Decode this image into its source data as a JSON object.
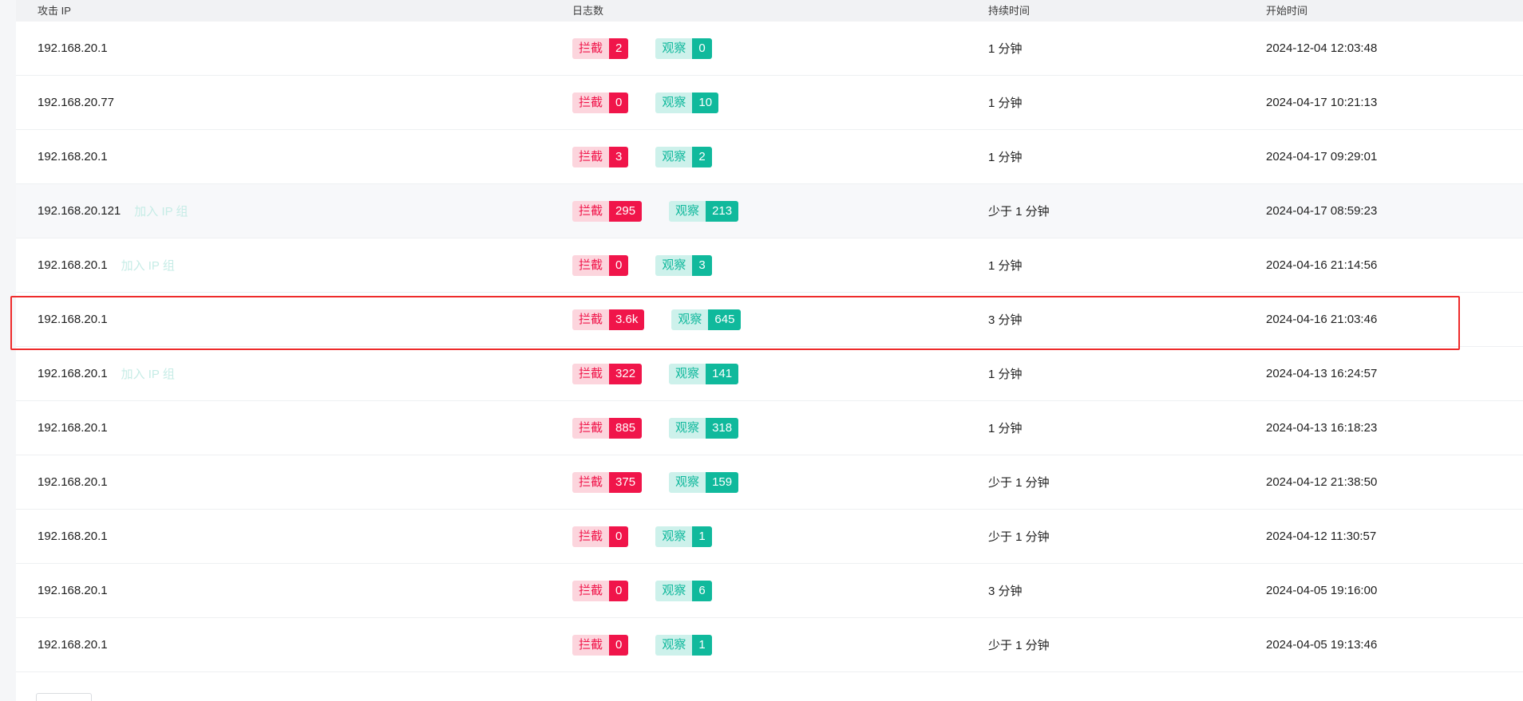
{
  "table": {
    "columns": {
      "ip": "攻击 IP",
      "logs": "日志数",
      "duration": "持续时间",
      "start_time": "开始时间"
    },
    "block_label": "拦截",
    "watch_label": "观察",
    "add_group_label": "加入 IP 组",
    "rows": [
      {
        "ip": "192.168.20.1",
        "block": "2",
        "watch": "0",
        "duration": "1 分钟",
        "start": "2024-12-04 12:03:48"
      },
      {
        "ip": "192.168.20.77",
        "block": "0",
        "watch": "10",
        "duration": "1 分钟",
        "start": "2024-04-17 10:21:13"
      },
      {
        "ip": "192.168.20.1",
        "block": "3",
        "watch": "2",
        "duration": "1 分钟",
        "start": "2024-04-17 09:29:01"
      },
      {
        "ip": "192.168.20.121",
        "block": "295",
        "watch": "213",
        "duration": "少于 1 分钟",
        "start": "2024-04-17 08:59:23"
      },
      {
        "ip": "192.168.20.1",
        "block": "0",
        "watch": "3",
        "duration": "1 分钟",
        "start": "2024-04-16 21:14:56"
      },
      {
        "ip": "192.168.20.1",
        "block": "3.6k",
        "watch": "645",
        "duration": "3 分钟",
        "start": "2024-04-16 21:03:46"
      },
      {
        "ip": "192.168.20.1",
        "block": "322",
        "watch": "141",
        "duration": "1 分钟",
        "start": "2024-04-13 16:24:57"
      },
      {
        "ip": "192.168.20.1",
        "block": "885",
        "watch": "318",
        "duration": "1 分钟",
        "start": "2024-04-13 16:18:23"
      },
      {
        "ip": "192.168.20.1",
        "block": "375",
        "watch": "159",
        "duration": "少于 1 分钟",
        "start": "2024-04-12 21:38:50"
      },
      {
        "ip": "192.168.20.1",
        "block": "0",
        "watch": "1",
        "duration": "少于 1 分钟",
        "start": "2024-04-12 11:30:57"
      },
      {
        "ip": "192.168.20.1",
        "block": "0",
        "watch": "6",
        "duration": "3 分钟",
        "start": "2024-04-05 19:16:00"
      },
      {
        "ip": "192.168.20.1",
        "block": "0",
        "watch": "1",
        "duration": "少于 1 分钟",
        "start": "2024-04-05 19:13:46"
      }
    ]
  },
  "colors": {
    "block_accent": "#f0154a",
    "watch_accent": "#10b99c",
    "highlight_border": "#ee2b2b"
  }
}
